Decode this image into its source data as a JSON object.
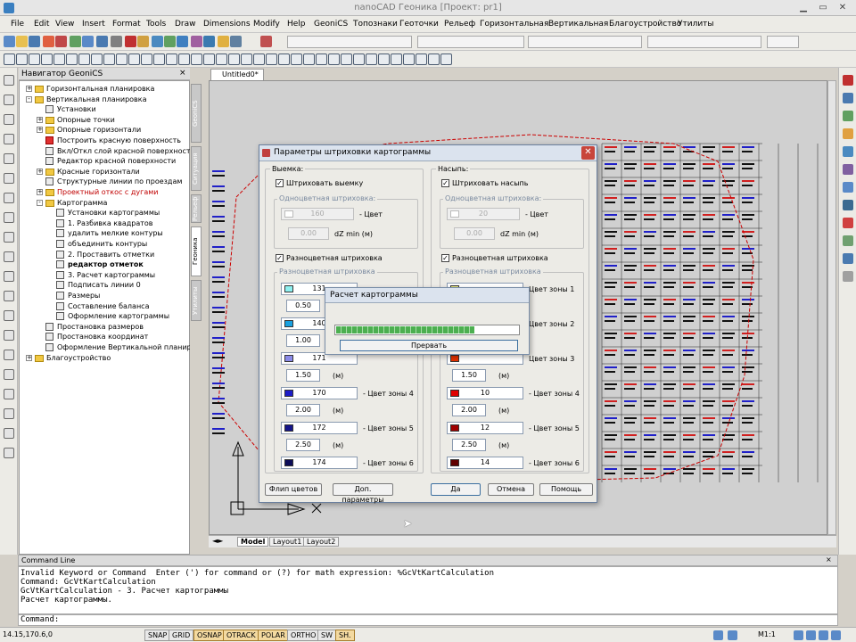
{
  "window": {
    "title": "nanoCAD Геоника [Проект: pr1]"
  },
  "menu": [
    "File",
    "Edit",
    "View",
    "Insert",
    "Format",
    "Tools",
    "Draw",
    "Dimensions",
    "Modify",
    "Help",
    "GeoniCS",
    "Топознаки",
    "Геоточки",
    "Рельеф",
    "Горизонтальная",
    "Вертикальная",
    "Благоустройство",
    "Утилиты"
  ],
  "navigator": {
    "title": "Навигатор GeoniCS",
    "items": [
      {
        "label": "Горизонтальная планировка",
        "level": 0,
        "kind": "folder",
        "expand": "+"
      },
      {
        "label": "Вертикальная планировка",
        "level": 0,
        "kind": "folder",
        "expand": "-"
      },
      {
        "label": "Установки",
        "level": 1,
        "kind": "leaf"
      },
      {
        "label": "Опорные точки",
        "level": 1,
        "kind": "folder",
        "expand": "+"
      },
      {
        "label": "Опорные горизонтали",
        "level": 1,
        "kind": "folder",
        "expand": "+"
      },
      {
        "label": "Построить красную поверхность",
        "level": 1,
        "kind": "leaf-red"
      },
      {
        "label": "Вкл/Откл слой красной поверхности",
        "level": 1,
        "kind": "leaf"
      },
      {
        "label": "Редактор красной поверхности",
        "level": 1,
        "kind": "leaf"
      },
      {
        "label": "Красные горизонтали",
        "level": 1,
        "kind": "folder",
        "expand": "+"
      },
      {
        "label": "Структурные линии по проездам",
        "level": 1,
        "kind": "leaf"
      },
      {
        "label": "Проектный откос с дугами",
        "level": 1,
        "kind": "folder",
        "expand": "+",
        "style": "red"
      },
      {
        "label": "Картограмма",
        "level": 1,
        "kind": "folder",
        "expand": "-"
      },
      {
        "label": "Установки картограммы",
        "level": 2,
        "kind": "leaf"
      },
      {
        "label": "1. Разбивка квадратов",
        "level": 2,
        "kind": "leaf"
      },
      {
        "label": "удалить мелкие контуры",
        "level": 2,
        "kind": "leaf"
      },
      {
        "label": "объединить контуры",
        "level": 2,
        "kind": "leaf"
      },
      {
        "label": "2. Проставить отметки",
        "level": 2,
        "kind": "leaf"
      },
      {
        "label": "редактор отметок",
        "level": 2,
        "kind": "leaf",
        "style": "bold"
      },
      {
        "label": "3. Расчет картограммы",
        "level": 2,
        "kind": "leaf"
      },
      {
        "label": "Подписать линии 0",
        "level": 2,
        "kind": "leaf"
      },
      {
        "label": "Размеры",
        "level": 2,
        "kind": "leaf"
      },
      {
        "label": "Составление баланса",
        "level": 2,
        "kind": "leaf"
      },
      {
        "label": "Оформление картограммы",
        "level": 2,
        "kind": "leaf"
      },
      {
        "label": "Простановка размеров",
        "level": 1,
        "kind": "leaf"
      },
      {
        "label": "Простановка координат",
        "level": 1,
        "kind": "leaf"
      },
      {
        "label": "Оформление Вертикальной планиров",
        "level": 1,
        "kind": "leaf"
      },
      {
        "label": "Благоустройство",
        "level": 0,
        "kind": "folder",
        "expand": "+"
      }
    ],
    "vtabs": [
      "GeoniCS",
      "Ситуация",
      "Рельеф",
      "Геоника",
      "Утилиты"
    ]
  },
  "document": {
    "tab": "Untitled0*",
    "layouts": [
      "Model",
      "Layout1",
      "Layout2"
    ]
  },
  "dialog": {
    "title": "Параметры штриховки картограммы",
    "cut": {
      "group": "Выемка:",
      "hatch_check": "Штриховать выемку",
      "single_group": "Одноцветная штриховка:",
      "single_color_value": "160",
      "color_label": "- Цвет",
      "dz_value": "0.00",
      "dz_label": "dZ min (м)",
      "multi_check": "Разноцветная штриховка",
      "multi_group": "Разноцветная штриховка",
      "zones": [
        {
          "color": "131",
          "hex": "#8ef0f0",
          "dz": "0.50",
          "zone": ""
        },
        {
          "color": "140",
          "hex": "#18a0e0",
          "dz": "1.00",
          "zone": ""
        },
        {
          "color": "171",
          "hex": "#8a8ae8",
          "dz": "1.50",
          "zone": ""
        },
        {
          "color": "170",
          "hex": "#1c1cc8",
          "dz": "2.00",
          "zone": "- Цвет зоны 4"
        },
        {
          "color": "172",
          "hex": "#14148a",
          "dz": "2.50",
          "zone": "- Цвет зоны 5"
        },
        {
          "color": "174",
          "hex": "#0c0c58",
          "dz": "",
          "zone": "- Цвет зоны 6"
        }
      ]
    },
    "fill": {
      "group": "Насыпь:",
      "hatch_check": "Штриховать насыпь",
      "single_group": "Одноцветная штриховка:",
      "single_color_value": "20",
      "color_label": "- Цвет",
      "dz_value": "0.00",
      "dz_label": "dZ min (м)",
      "multi_check": "Разноцветная штриховка",
      "multi_group": "Разноцветная штриховка",
      "zones": [
        {
          "color": "",
          "hex": "#f0f080",
          "dz": "",
          "zone": "Цвет зоны 1"
        },
        {
          "color": "",
          "hex": "#f0a000",
          "dz": "",
          "zone": "Цвет зоны 2"
        },
        {
          "color": "",
          "hex": "#e03000",
          "dz": "1.50",
          "zone": "Цвет зоны 3"
        },
        {
          "color": "10",
          "hex": "#e00000",
          "dz": "2.00",
          "zone": "- Цвет зоны 4"
        },
        {
          "color": "12",
          "hex": "#a00000",
          "dz": "2.50",
          "zone": "- Цвет зоны 5"
        },
        {
          "color": "14",
          "hex": "#600000",
          "dz": "",
          "zone": "- Цвет зоны 6"
        }
      ]
    },
    "unit": "(м)",
    "buttons": {
      "flip": "Флип цветов",
      "extra": "Доп. параметры",
      "ok": "Да",
      "cancel": "Отмена",
      "help": "Помощь"
    }
  },
  "progress": {
    "title": "Расчет картограммы",
    "cancel": "Прервать",
    "value": 0.75
  },
  "command": {
    "title": "Command Line",
    "history": [
      "Invalid Keyword or Command  Enter (') for command or (?) for math expression: %GcVtKartCalculation",
      "Command: GcVtKartCalculation",
      "GcVtKartCalculation - 3. Расчет картограммы",
      "Расчет картограммы."
    ],
    "prompt": "Command:"
  },
  "status": {
    "coords": "14.15,170.6,0",
    "buttons": [
      {
        "label": "SNAP",
        "on": false
      },
      {
        "label": "GRID",
        "on": false
      },
      {
        "label": "OSNAP",
        "on": true
      },
      {
        "label": "OTRACK",
        "on": true
      },
      {
        "label": "POLAR",
        "on": true
      },
      {
        "label": "ORTHO",
        "on": false
      },
      {
        "label": "SW",
        "on": false
      },
      {
        "label": "SH.",
        "on": true
      }
    ],
    "scale": "M1:1"
  },
  "colors": {
    "accent": "#3c6fa0",
    "progress": "#4caf50"
  }
}
